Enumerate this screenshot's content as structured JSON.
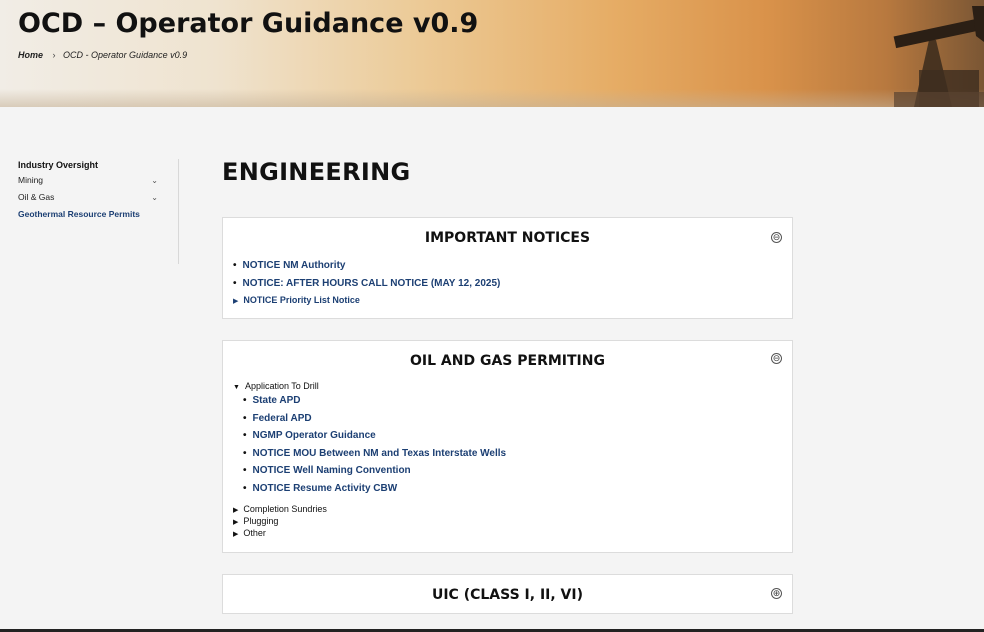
{
  "header": {
    "title": "OCD – Operator Guidance v0.9",
    "breadcrumb": {
      "home": "Home",
      "separator": "›",
      "current": "OCD - Operator Guidance v0.9"
    }
  },
  "sidebar": {
    "heading": "Industry Oversight",
    "items": [
      {
        "label": "Mining",
        "icon": "chevron-down-icon"
      },
      {
        "label": "Oil & Gas",
        "icon": "chevron-down-icon"
      },
      {
        "label": "Geothermal Resource Permits"
      }
    ],
    "chevron": "⌄"
  },
  "main": {
    "title": "ENGINEERING",
    "sections": [
      {
        "title": "IMPORTANT NOTICES",
        "state": "expanded",
        "toggle": "⊖",
        "links": [
          "NOTICE NM Authority",
          "NOTICE: AFTER HOURS CALL NOTICE (MAY 12, 2025)"
        ],
        "collapsed_groups": [
          "NOTICE Priority List Notice"
        ]
      },
      {
        "title": "OIL AND GAS PERMITING",
        "state": "expanded",
        "toggle": "⊖",
        "open_group": {
          "label": "Application To Drill",
          "items": [
            "State APD",
            "Federal APD",
            "NGMP Operator Guidance",
            "NOTICE MOU Between NM and Texas Interstate Wells",
            "NOTICE Well Naming Convention",
            "NOTICE Resume Activity CBW"
          ]
        },
        "collapsed_groups": [
          "Completion Sundries",
          "Plugging",
          "Other"
        ]
      },
      {
        "title": "UIC (CLASS I, II, VI)",
        "state": "collapsed",
        "toggle": "⊕"
      }
    ]
  },
  "colors": {
    "link": "#1c3f73",
    "panel_border": "#dcdcdc",
    "page_bg": "#f4f4f4",
    "banner_warm": "#d9924a"
  }
}
